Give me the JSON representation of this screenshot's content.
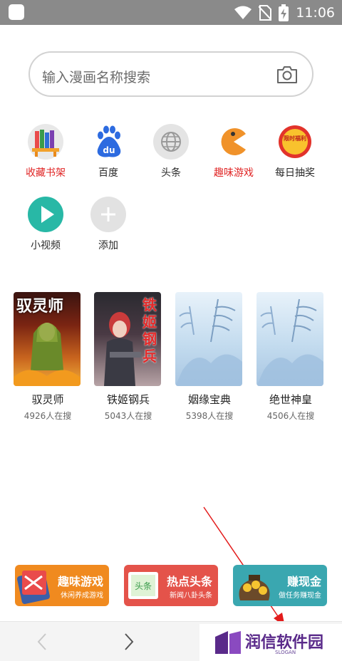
{
  "status_bar": {
    "time": "11:06"
  },
  "search": {
    "placeholder": "输入漫画名称搜索"
  },
  "shortcuts": [
    {
      "label": "收藏书架"
    },
    {
      "label": "百度"
    },
    {
      "label": "头条"
    },
    {
      "label": "趣味游戏"
    },
    {
      "label": "每日抽奖"
    },
    {
      "label": "小视频"
    },
    {
      "label": "添加"
    }
  ],
  "icon_texts": {
    "baidu": "du",
    "lottery": "限时福利"
  },
  "comics": [
    {
      "title": "驭灵师",
      "count": "4926人在搜",
      "cover_text": "驭灵师"
    },
    {
      "title": "铁姬钢兵",
      "count": "5043人在搜",
      "cover_text": "铁姬钢兵"
    },
    {
      "title": "姻缘宝典",
      "count": "5398人在搜"
    },
    {
      "title": "绝世神皇",
      "count": "4506人在搜"
    }
  ],
  "banners": [
    {
      "title": "趣味游戏",
      "subtitle": "休闲养成游戏",
      "color": "#f08a1f"
    },
    {
      "title": "热点头条",
      "subtitle": "新闻八卦头条",
      "color": "#e4534a",
      "badge": "头条"
    },
    {
      "title": "赚现金",
      "subtitle": "做任务赚现金",
      "color": "#3aa7b0"
    }
  ],
  "watermark": {
    "text": "润信软件园",
    "slogan": "SLOGAN"
  },
  "colors": {
    "accent_red": "#e02424",
    "status_bar": "#8a8a8a"
  }
}
